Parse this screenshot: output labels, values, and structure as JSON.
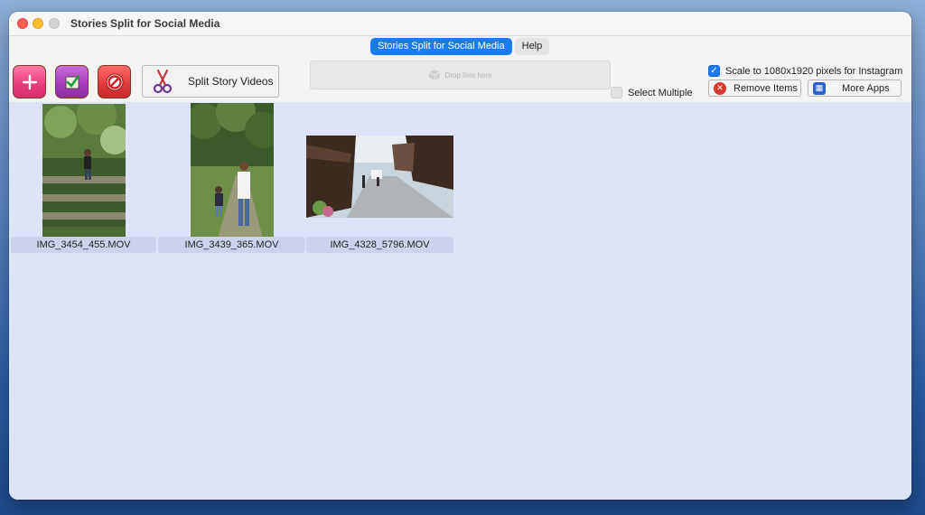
{
  "window": {
    "title": "Stories Split for Social Media"
  },
  "tabs": [
    {
      "label": "Stories Split for Social Media",
      "active": true
    },
    {
      "label": "Help",
      "active": false
    }
  ],
  "toolbar": {
    "add_icon": "plus-icon",
    "check_icon": "checkmark-icon",
    "stop_icon": "no-entry-icon",
    "split_label": "Split Story Videos",
    "drop_placeholder": "Drop files here",
    "select_multiple_label": "Select Multiple",
    "scale_label": "Scale to 1080x1920 pixels for Instagram",
    "scale_checked": true,
    "remove_label": "Remove Items",
    "more_apps_label": "More Apps"
  },
  "items": [
    {
      "name": "IMG_3454_455.MOV"
    },
    {
      "name": "IMG_3439_365.MOV"
    },
    {
      "name": "IMG_4328_5796.MOV"
    }
  ],
  "colors": {
    "accent": "#1a7cf5",
    "content_bg": "#dfe3fa",
    "label_bg": "#ccd1ec"
  }
}
